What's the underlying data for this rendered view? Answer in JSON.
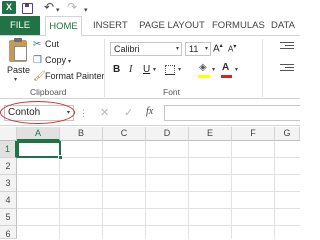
{
  "quick_access": {
    "app_badge": "X",
    "undo_caret": "▾",
    "more_caret": "▾"
  },
  "tabs": [
    {
      "label": "FILE"
    },
    {
      "label": "HOME"
    },
    {
      "label": "INSERT"
    },
    {
      "label": "PAGE LAYOUT"
    },
    {
      "label": "FORMULAS"
    },
    {
      "label": "DATA"
    }
  ],
  "clipboard": {
    "paste_label": "Paste",
    "cut_label": "Cut",
    "copy_label": "Copy",
    "format_painter_label": "Format Painter",
    "group_label": "Clipboard"
  },
  "font": {
    "name": "Calibri",
    "size": "11",
    "bold": "B",
    "italic": "I",
    "underline": "U",
    "font_color_glyph": "A",
    "group_label": "Font",
    "fill_color": "#ffff00",
    "font_color": "#e02020"
  },
  "formula_bar": {
    "name_box": "Contoh",
    "fx": "fx",
    "cancel_glyph": "✕",
    "enter_glyph": "✓"
  },
  "grid": {
    "columns": [
      "A",
      "B",
      "C",
      "D",
      "E",
      "F",
      "G"
    ],
    "rows": [
      "1",
      "2",
      "3",
      "4",
      "5",
      "6",
      "7"
    ],
    "active_cell": "A1"
  },
  "colors": {
    "accent": "#217346",
    "highlight_ring": "#d1302f"
  }
}
